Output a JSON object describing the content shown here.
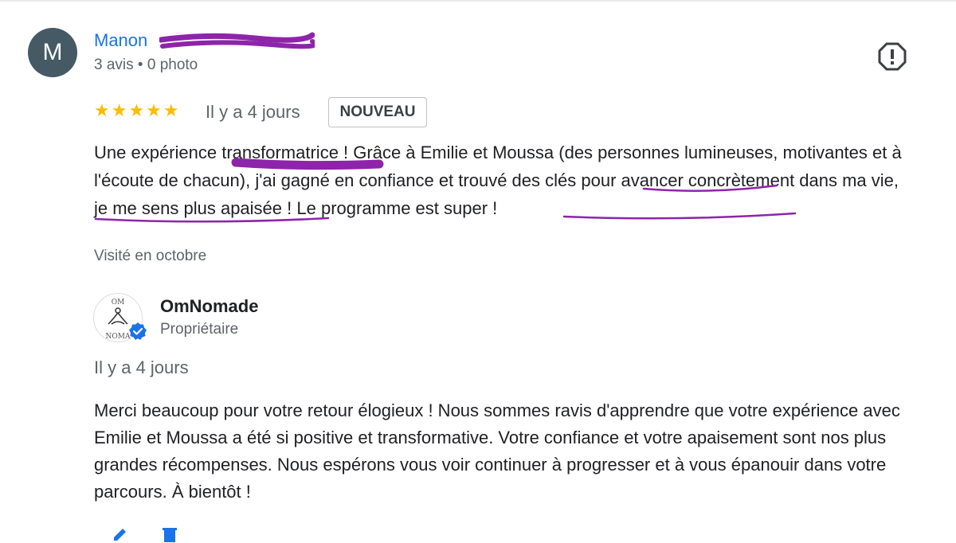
{
  "review": {
    "avatar_letter": "M",
    "author_name": "Manon",
    "author_meta": "3 avis • 0 photo",
    "rating": 5,
    "stars": "★★★★★",
    "time": "Il y a 4 jours",
    "badge": "NOUVEAU",
    "text": {
      "p1": "Une expérience ",
      "h1": "transformatrice !",
      "p2": " Grâce à Emilie et Moussa (des personnes lumineuses, motivantes et à l'écoute de chacun), j'ai gagné en confiance et ",
      "h2": "trouvé des clés",
      "p3": " pour avancer ",
      "h3": "concrètement dans ma vie",
      "p4": ", je me sens plus apaisée ! ",
      "h4": "Le programme est super !"
    },
    "visited": "Visité en octobre"
  },
  "owner": {
    "logo_top": "OM",
    "logo_bottom": "NOMA",
    "name": "OmNomade",
    "role": "Propriétaire",
    "time": "Il y a 4 jours",
    "reply": "Merci beaucoup pour votre retour élogieux ! Nous sommes ravis d'apprendre que votre expérience avec Emilie et Moussa a été si positive et transformative. Votre confiance et votre apaisement sont nos plus grandes récompenses. Nous espérons vous voir continuer à progresser et à vous épanouir dans votre parcours. À bientôt !"
  },
  "colors": {
    "link": "#1a73e8",
    "star": "#fbbc04",
    "annotation": "#8e24aa",
    "avatar": "#455a64"
  },
  "icons": [
    "report-icon",
    "verified-icon",
    "edit-icon",
    "delete-icon"
  ]
}
